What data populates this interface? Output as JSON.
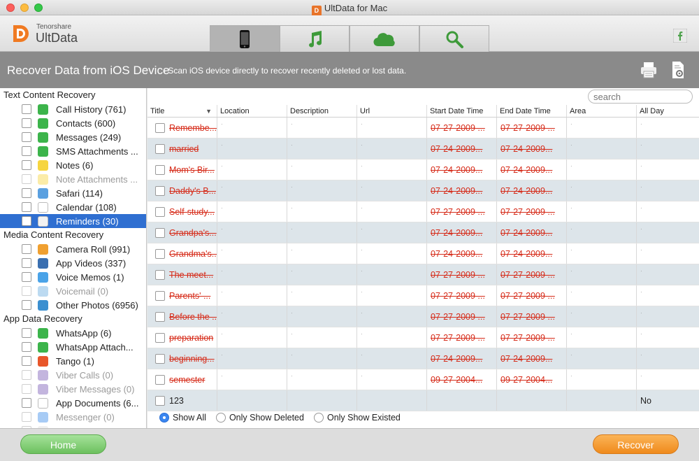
{
  "window": {
    "title": "UltData for Mac",
    "app_icon_text": "D"
  },
  "header": {
    "brand_small": "Tenorshare",
    "brand": "UltData",
    "tabs": [
      "ios-device-icon",
      "music-icon",
      "cloud-icon",
      "repair-icon"
    ],
    "active_tab": 0
  },
  "banner": {
    "title": "Recover Data from iOS Device",
    "subtitle": "- Scan iOS device directly to recover recently deleted or lost data."
  },
  "sidebar": {
    "sections": [
      {
        "title": "Text Content Recovery",
        "items": [
          {
            "label": "Call History (761)",
            "icon": "phone-icon",
            "color": "#3cb44b",
            "state": "normal"
          },
          {
            "label": "Contacts (600)",
            "icon": "contacts-icon",
            "color": "#3cb44b",
            "state": "normal"
          },
          {
            "label": "Messages (249)",
            "icon": "messages-icon",
            "color": "#3cb44b",
            "state": "normal"
          },
          {
            "label": "SMS Attachments ...",
            "icon": "attachment-icon",
            "color": "#3cb44b",
            "state": "normal"
          },
          {
            "label": "Notes (6)",
            "icon": "notes-icon",
            "color": "#f6d53f",
            "state": "normal"
          },
          {
            "label": "Note Attachments ...",
            "icon": "note-attachment-icon",
            "color": "#f6d53f",
            "state": "disabled"
          },
          {
            "label": "Safari (114)",
            "icon": "safari-icon",
            "color": "#5aa0e0",
            "state": "normal"
          },
          {
            "label": "Calendar (108)",
            "icon": "calendar-icon",
            "color": "#ffffff",
            "state": "normal"
          },
          {
            "label": "Reminders (30)",
            "icon": "reminders-icon",
            "color": "#f2f2f2",
            "state": "selected"
          }
        ]
      },
      {
        "title": "Media Content Recovery",
        "items": [
          {
            "label": "Camera Roll (991)",
            "icon": "photos-icon",
            "color": "#f0a030",
            "state": "normal"
          },
          {
            "label": "App Videos (337)",
            "icon": "video-icon",
            "color": "#3a6fb0",
            "state": "normal"
          },
          {
            "label": "Voice Memos (1)",
            "icon": "microphone-icon",
            "color": "#4aa3e8",
            "state": "normal"
          },
          {
            "label": "Voicemail (0)",
            "icon": "voicemail-icon",
            "color": "#6aaee0",
            "state": "disabled"
          },
          {
            "label": "Other Photos (6956)",
            "icon": "landscape-icon",
            "color": "#3b8fd0",
            "state": "normal"
          }
        ]
      },
      {
        "title": "App Data Recovery",
        "items": [
          {
            "label": "WhatsApp (6)",
            "icon": "whatsapp-icon",
            "color": "#3cb44b",
            "state": "normal"
          },
          {
            "label": "WhatsApp Attach...",
            "icon": "whatsapp-attachment-icon",
            "color": "#3cb44b",
            "state": "normal"
          },
          {
            "label": "Tango (1)",
            "icon": "tango-icon",
            "color": "#e8562a",
            "state": "normal"
          },
          {
            "label": "Viber Calls (0)",
            "icon": "viber-icon",
            "color": "#7b5bb6",
            "state": "disabled"
          },
          {
            "label": "Viber Messages (0)",
            "icon": "viber-icon",
            "color": "#7b5bb6",
            "state": "disabled"
          },
          {
            "label": "App Documents (6...",
            "icon": "document-icon",
            "color": "#ffffff",
            "state": "normal"
          },
          {
            "label": "Messenger (0)",
            "icon": "messenger-icon",
            "color": "#3b8be8",
            "state": "disabled"
          },
          {
            "label": "",
            "icon": "blank-icon",
            "color": "#dddddd",
            "state": "disabled"
          }
        ]
      }
    ]
  },
  "main": {
    "search_placeholder": "search",
    "columns": [
      "Title",
      "Location",
      "Description",
      "Url",
      "Start Date Time",
      "End Date Time",
      "Area",
      "All Day"
    ],
    "rows": [
      {
        "title": "Remembe...",
        "start": "07-27-2009 ...",
        "end": "07-27-2009 ...",
        "all_day": "",
        "deleted": true
      },
      {
        "title": " married",
        "start": "07-24-2009...",
        "end": "07-24-2009...",
        "all_day": "",
        "deleted": true
      },
      {
        "title": "Mom's Bir...",
        "start": "07-24-2009...",
        "end": "07-24-2009...",
        "all_day": "",
        "deleted": true
      },
      {
        "title": "Daddy's B...",
        "start": "07-24-2009...",
        "end": "07-24-2009...",
        "all_day": "",
        "deleted": true
      },
      {
        "title": "Self-study...",
        "start": "07-27-2009 ...",
        "end": "07-27-2009 ...",
        "all_day": "",
        "deleted": true
      },
      {
        "title": "Grandpa's...",
        "start": "07-24-2009...",
        "end": "07-24-2009...",
        "all_day": "",
        "deleted": true
      },
      {
        "title": "Grandma's...",
        "start": "07-24-2009...",
        "end": "07-24-2009...",
        "all_day": "",
        "deleted": true
      },
      {
        "title": "The meet...",
        "start": "07-27-2009 ...",
        "end": "07-27-2009 ...",
        "all_day": "",
        "deleted": true
      },
      {
        "title": "Parents' ...",
        "start": "07-27-2009 ...",
        "end": "07-27-2009 ...",
        "all_day": "",
        "deleted": true
      },
      {
        "title": "Before the ...",
        "start": "07-27-2009 ...",
        "end": "07-27-2009 ...",
        "all_day": "",
        "deleted": true
      },
      {
        "title": "preparation",
        "start": "07-27-2009 ...",
        "end": "07-27-2009 ...",
        "all_day": "",
        "deleted": true
      },
      {
        "title": "beginning...",
        "start": "07-24-2009...",
        "end": "07-24-2009...",
        "all_day": "",
        "deleted": true
      },
      {
        "title": "semester",
        "start": "09-27-2004...",
        "end": "09-27-2004...",
        "all_day": "",
        "deleted": true
      },
      {
        "title": "123",
        "start": "",
        "end": "",
        "all_day": "No",
        "deleted": false
      }
    ],
    "filters": [
      {
        "label": "Show All",
        "checked": true
      },
      {
        "label": "Only Show Deleted",
        "checked": false
      },
      {
        "label": "Only Show Existed",
        "checked": false
      }
    ]
  },
  "footer": {
    "home_label": "Home",
    "recover_label": "Recover"
  }
}
